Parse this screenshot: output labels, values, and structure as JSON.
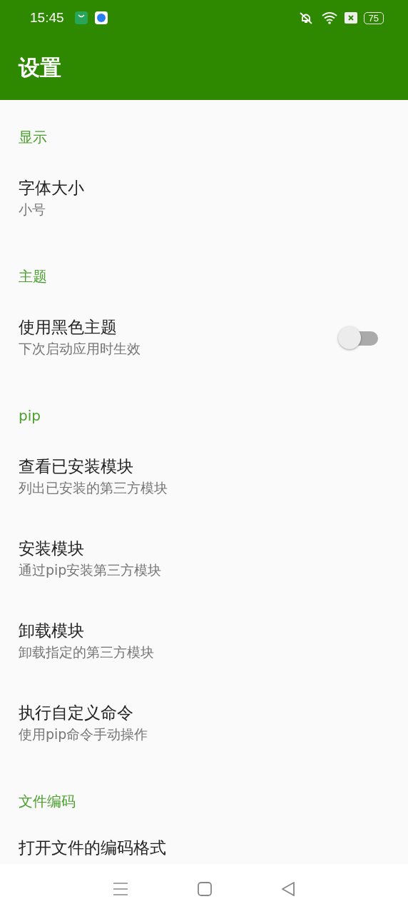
{
  "status_bar": {
    "time": "15:45",
    "battery": "75"
  },
  "toolbar": {
    "title": "设置"
  },
  "sections": [
    {
      "header": "显示",
      "items": [
        {
          "kind": "plain",
          "title": "字体大小",
          "summary": "小号"
        }
      ]
    },
    {
      "header": "主题",
      "items": [
        {
          "kind": "switch",
          "title": "使用黑色主题",
          "summary": "下次启动应用时生效",
          "on": false
        }
      ]
    },
    {
      "header": "pip",
      "items": [
        {
          "kind": "plain",
          "title": "查看已安装模块",
          "summary": "列出已安装的第三方模块"
        },
        {
          "kind": "plain",
          "title": "安装模块",
          "summary": "通过pip安装第三方模块"
        },
        {
          "kind": "plain",
          "title": "卸载模块",
          "summary": "卸载指定的第三方模块"
        },
        {
          "kind": "plain",
          "title": "执行自定义命令",
          "summary": "使用pip命令手动操作"
        }
      ]
    },
    {
      "header": "文件编码",
      "items": [
        {
          "kind": "plain",
          "title": "打开文件的编码格式"
        }
      ]
    }
  ]
}
